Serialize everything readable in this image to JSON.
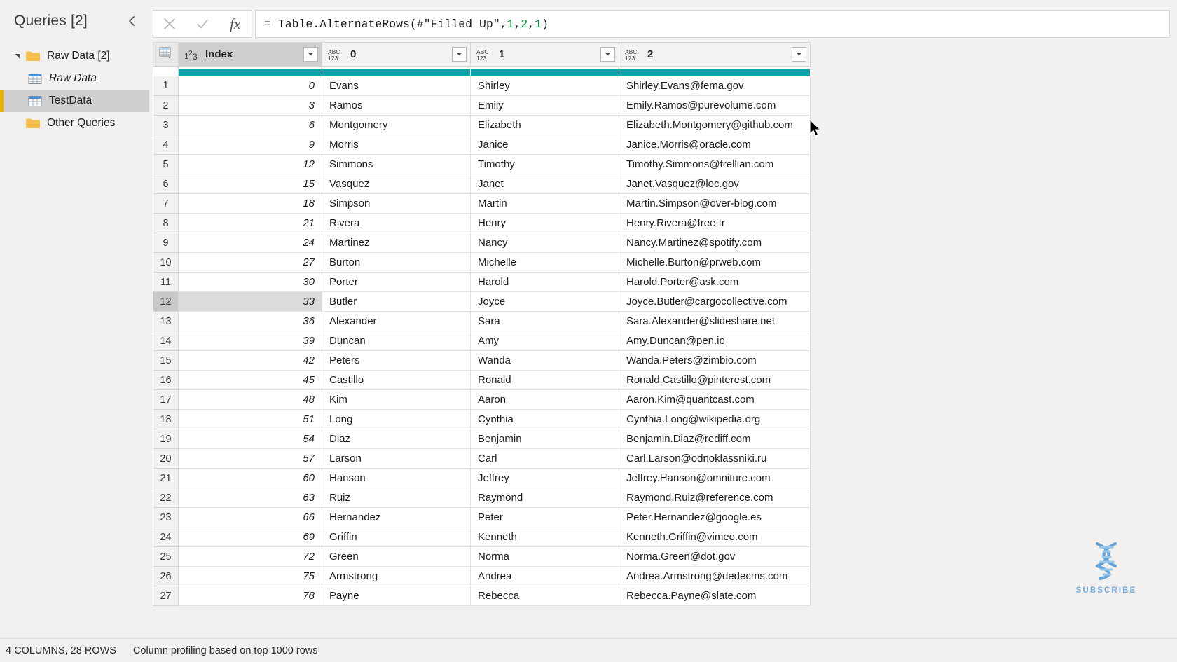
{
  "sidebar": {
    "title": "Queries [2]",
    "collapse_icon": "chevron-left-icon",
    "items": [
      {
        "label": "Raw Data [2]",
        "type": "folder",
        "level": "group",
        "expanded": true,
        "italic": false,
        "selected": false
      },
      {
        "label": "Raw Data",
        "type": "table",
        "level": "child",
        "italic": true,
        "selected": false
      },
      {
        "label": "TestData",
        "type": "table",
        "level": "child",
        "italic": false,
        "selected": true
      },
      {
        "label": "Other Queries",
        "type": "folder",
        "level": "group",
        "expanded": false,
        "italic": false,
        "selected": false
      }
    ]
  },
  "formula_bar": {
    "cancel_icon": "close-icon",
    "commit_icon": "check-icon",
    "fx_label": "fx",
    "formula_prefix": "= Table.AlternateRows(#\"Filled Up\",",
    "formula_args": [
      "1",
      "2",
      "1"
    ],
    "formula_suffix": ")",
    "formula_full": "= Table.AlternateRows(#\"Filled Up\",1,2,1)"
  },
  "grid": {
    "select_all_icon": "table-select-icon",
    "columns": [
      {
        "name": "Index",
        "type_icon": "whole-number-icon",
        "type_glyph": "123",
        "active": true
      },
      {
        "name": "0",
        "type_icon": "any-type-icon",
        "type_glyph": "ABC123",
        "active": false
      },
      {
        "name": "1",
        "type_icon": "any-type-icon",
        "type_glyph": "ABC123",
        "active": false
      },
      {
        "name": "2",
        "type_icon": "any-type-icon",
        "type_glyph": "ABC123",
        "active": false
      }
    ],
    "quality_bar_color": "#0ba3ac",
    "highlight_row": 12,
    "rows": [
      {
        "n": "1",
        "index": "0",
        "c0": "Evans",
        "c1": "Shirley",
        "c2": "Shirley.Evans@fema.gov"
      },
      {
        "n": "2",
        "index": "3",
        "c0": "Ramos",
        "c1": "Emily",
        "c2": "Emily.Ramos@purevolume.com"
      },
      {
        "n": "3",
        "index": "6",
        "c0": "Montgomery",
        "c1": "Elizabeth",
        "c2": "Elizabeth.Montgomery@github.com"
      },
      {
        "n": "4",
        "index": "9",
        "c0": "Morris",
        "c1": "Janice",
        "c2": "Janice.Morris@oracle.com"
      },
      {
        "n": "5",
        "index": "12",
        "c0": "Simmons",
        "c1": "Timothy",
        "c2": "Timothy.Simmons@trellian.com"
      },
      {
        "n": "6",
        "index": "15",
        "c0": "Vasquez",
        "c1": "Janet",
        "c2": "Janet.Vasquez@loc.gov"
      },
      {
        "n": "7",
        "index": "18",
        "c0": "Simpson",
        "c1": "Martin",
        "c2": "Martin.Simpson@over-blog.com"
      },
      {
        "n": "8",
        "index": "21",
        "c0": "Rivera",
        "c1": "Henry",
        "c2": "Henry.Rivera@free.fr"
      },
      {
        "n": "9",
        "index": "24",
        "c0": "Martinez",
        "c1": "Nancy",
        "c2": "Nancy.Martinez@spotify.com"
      },
      {
        "n": "10",
        "index": "27",
        "c0": "Burton",
        "c1": "Michelle",
        "c2": "Michelle.Burton@prweb.com"
      },
      {
        "n": "11",
        "index": "30",
        "c0": "Porter",
        "c1": "Harold",
        "c2": "Harold.Porter@ask.com"
      },
      {
        "n": "12",
        "index": "33",
        "c0": "Butler",
        "c1": "Joyce",
        "c2": "Joyce.Butler@cargocollective.com"
      },
      {
        "n": "13",
        "index": "36",
        "c0": "Alexander",
        "c1": "Sara",
        "c2": "Sara.Alexander@slideshare.net"
      },
      {
        "n": "14",
        "index": "39",
        "c0": "Duncan",
        "c1": "Amy",
        "c2": "Amy.Duncan@pen.io"
      },
      {
        "n": "15",
        "index": "42",
        "c0": "Peters",
        "c1": "Wanda",
        "c2": "Wanda.Peters@zimbio.com"
      },
      {
        "n": "16",
        "index": "45",
        "c0": "Castillo",
        "c1": "Ronald",
        "c2": "Ronald.Castillo@pinterest.com"
      },
      {
        "n": "17",
        "index": "48",
        "c0": "Kim",
        "c1": "Aaron",
        "c2": "Aaron.Kim@quantcast.com"
      },
      {
        "n": "18",
        "index": "51",
        "c0": "Long",
        "c1": "Cynthia",
        "c2": "Cynthia.Long@wikipedia.org"
      },
      {
        "n": "19",
        "index": "54",
        "c0": "Diaz",
        "c1": "Benjamin",
        "c2": "Benjamin.Diaz@rediff.com"
      },
      {
        "n": "20",
        "index": "57",
        "c0": "Larson",
        "c1": "Carl",
        "c2": "Carl.Larson@odnoklassniki.ru"
      },
      {
        "n": "21",
        "index": "60",
        "c0": "Hanson",
        "c1": "Jeffrey",
        "c2": "Jeffrey.Hanson@omniture.com"
      },
      {
        "n": "22",
        "index": "63",
        "c0": "Ruiz",
        "c1": "Raymond",
        "c2": "Raymond.Ruiz@reference.com"
      },
      {
        "n": "23",
        "index": "66",
        "c0": "Hernandez",
        "c1": "Peter",
        "c2": "Peter.Hernandez@google.es"
      },
      {
        "n": "24",
        "index": "69",
        "c0": "Griffin",
        "c1": "Kenneth",
        "c2": "Kenneth.Griffin@vimeo.com"
      },
      {
        "n": "25",
        "index": "72",
        "c0": "Green",
        "c1": "Norma",
        "c2": "Norma.Green@dot.gov"
      },
      {
        "n": "26",
        "index": "75",
        "c0": "Armstrong",
        "c1": "Andrea",
        "c2": "Andrea.Armstrong@dedecms.com"
      },
      {
        "n": "27",
        "index": "78",
        "c0": "Payne",
        "c1": "Rebecca",
        "c2": "Rebecca.Payne@slate.com"
      }
    ]
  },
  "status": {
    "columns_rows": "4 COLUMNS, 28 ROWS",
    "profiling": "Column profiling based on top 1000 rows"
  },
  "watermark": {
    "icon": "dna-helix-icon",
    "label": "SUBSCRIBE",
    "color": "#69a8e0"
  },
  "cursor": {
    "icon": "mouse-pointer-icon"
  }
}
